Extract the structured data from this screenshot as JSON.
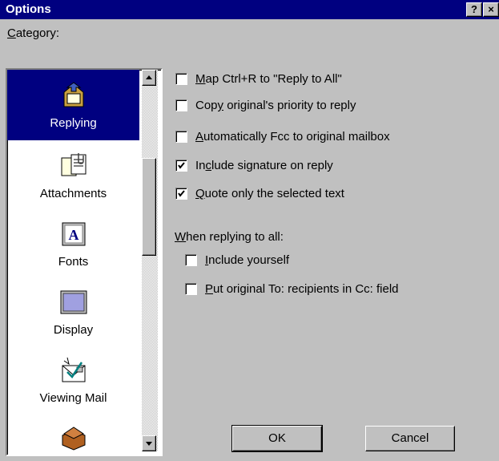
{
  "window": {
    "title": "Options",
    "help_button": "?",
    "close_button": "×"
  },
  "category": {
    "label_accel": "C",
    "label_rest": "ategory:",
    "items": [
      {
        "label": "Replying",
        "icon": "reply-icon",
        "selected": true
      },
      {
        "label": "Attachments",
        "icon": "attachments-icon",
        "selected": false
      },
      {
        "label": "Fonts",
        "icon": "fonts-icon",
        "selected": false
      },
      {
        "label": "Display",
        "icon": "display-icon",
        "selected": false
      },
      {
        "label": "Viewing Mail",
        "icon": "viewing-mail-icon",
        "selected": false
      },
      {
        "label": "",
        "icon": "mailbox-tray-icon",
        "selected": false
      }
    ]
  },
  "options": [
    {
      "pre": "",
      "accel": "M",
      "post": "ap Ctrl+R to \"Reply to All\"",
      "checked": false
    },
    {
      "pre": "Cop",
      "accel": "y",
      "post": " original's priority to reply",
      "checked": false
    },
    {
      "pre": "",
      "accel": "A",
      "post": "utomatically Fcc to original mailbox",
      "checked": false
    },
    {
      "pre": "In",
      "accel": "c",
      "post": "lude signature on reply",
      "checked": true
    },
    {
      "pre": "",
      "accel": "Q",
      "post": "uote only the selected text",
      "checked": true
    }
  ],
  "reply_all": {
    "label_accel": "W",
    "label_rest": "hen replying to all:",
    "options": [
      {
        "pre": "",
        "accel": "I",
        "post": "nclude yourself",
        "checked": false
      },
      {
        "pre": "",
        "accel": "P",
        "post": "ut original To: recipients in Cc: field",
        "checked": false
      }
    ]
  },
  "buttons": {
    "ok": "OK",
    "cancel": "Cancel"
  },
  "colors": {
    "title_bar": "#000080",
    "dialog_face": "#c0c0c0",
    "selection": "#000080"
  }
}
